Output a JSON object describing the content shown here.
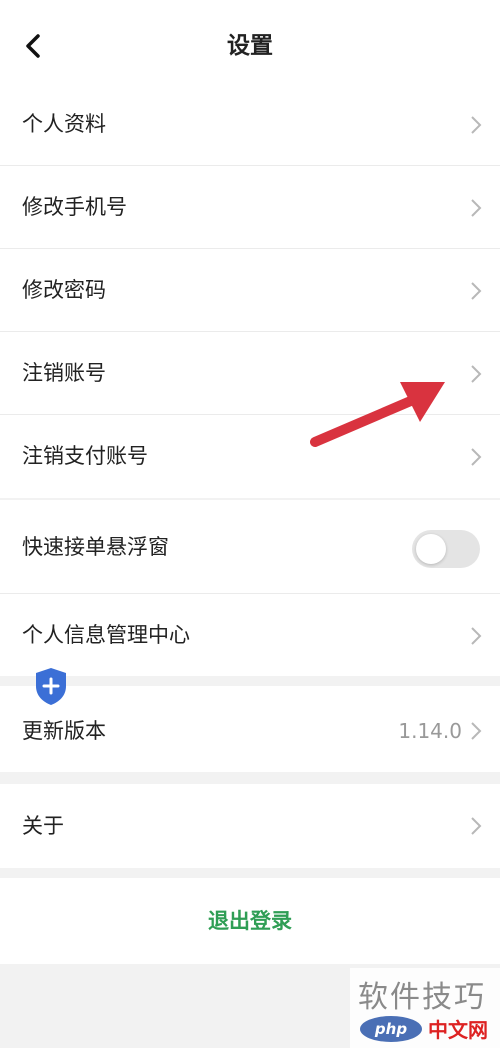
{
  "header": {
    "title": "设置",
    "back_icon": "chevron-left-icon"
  },
  "group1": {
    "items": [
      {
        "label": "个人资料"
      },
      {
        "label": "修改手机号"
      },
      {
        "label": "修改密码"
      },
      {
        "label": "注销账号"
      },
      {
        "label": "注销支付账号"
      }
    ]
  },
  "group2": {
    "toggle_item": {
      "label": "快速接单悬浮窗",
      "state": "off"
    },
    "info_center": {
      "label": "个人信息管理中心"
    }
  },
  "group3": {
    "version_item": {
      "label": "更新版本",
      "value": "1.14.0"
    }
  },
  "group4": {
    "about_item": {
      "label": "关于"
    }
  },
  "logout": {
    "label": "退出登录",
    "color": "#2f9e55"
  },
  "overlay": {
    "arrow_color": "#d9333f",
    "shield_color": "#3b6fd6",
    "watermark": {
      "text": "软件技巧",
      "php": "php",
      "cn": "中文网"
    }
  }
}
